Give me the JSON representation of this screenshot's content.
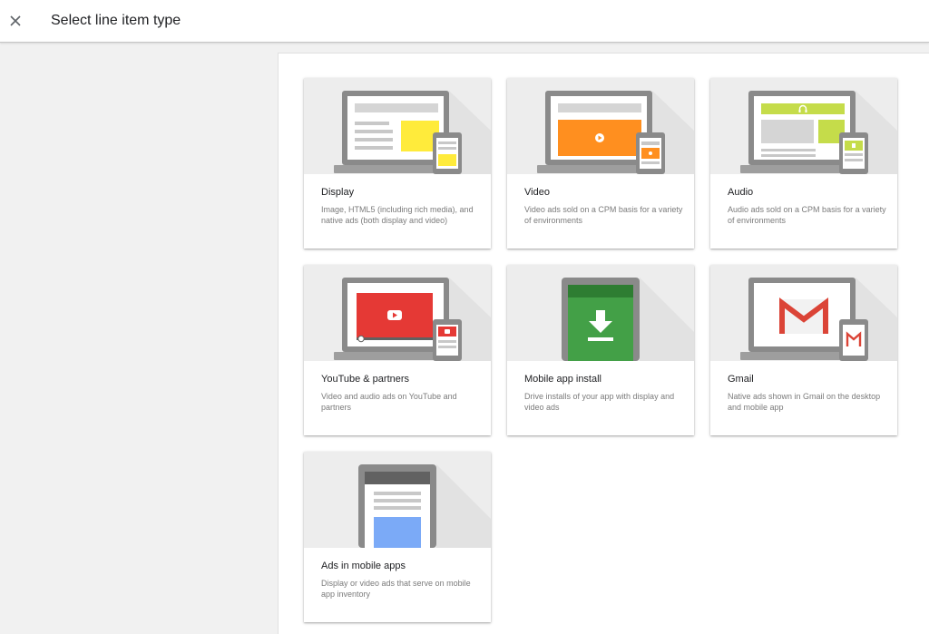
{
  "header": {
    "title": "Select line item type",
    "close_icon": "close-icon"
  },
  "cards": [
    {
      "id": "display",
      "title": "Display",
      "description": "Image, HTML5 (including rich media), and native ads (both display and video)",
      "icon": "display-illustration",
      "accent": "#ffeb3b"
    },
    {
      "id": "video",
      "title": "Video",
      "description": "Video ads sold on a CPM basis for a variety of environments",
      "icon": "video-illustration",
      "accent": "#ff8f1f"
    },
    {
      "id": "audio",
      "title": "Audio",
      "description": "Audio ads sold on a CPM basis for a variety of environments",
      "icon": "audio-illustration",
      "accent": "#c5dc4a"
    },
    {
      "id": "youtube",
      "title": "YouTube & partners",
      "description": "Video and audio ads on YouTube and partners",
      "icon": "youtube-illustration",
      "accent": "#e53935"
    },
    {
      "id": "mobile-app-install",
      "title": "Mobile app install",
      "description": "Drive installs of your app with display and video ads",
      "icon": "app-install-illustration",
      "accent": "#43a047"
    },
    {
      "id": "gmail",
      "title": "Gmail",
      "description": "Native ads shown in Gmail on the desktop and mobile app",
      "icon": "gmail-illustration",
      "accent": "#db4437"
    },
    {
      "id": "mobile-apps",
      "title": "Ads in mobile apps",
      "description": "Display or video ads that serve on mobile app inventory",
      "icon": "mobile-apps-illustration",
      "accent": "#7baaf7"
    }
  ]
}
